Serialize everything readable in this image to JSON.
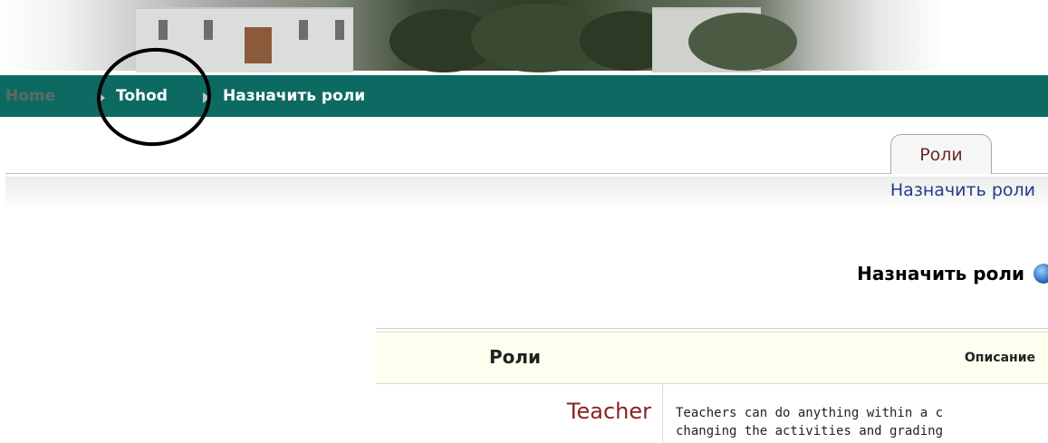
{
  "breadcrumb": {
    "home": "Home",
    "course": "Tohod",
    "current": "Назначить роли"
  },
  "tabs": {
    "active_label": "Роли",
    "sub_link": "Назначить роли"
  },
  "main": {
    "heading": "Назначить роли"
  },
  "table": {
    "headers": {
      "roles": "Роли",
      "description": "Описание"
    },
    "rows": [
      {
        "role": "Teacher",
        "description_line1": "Teachers can do anything within a c",
        "description_line2": "changing the activities and grading"
      }
    ]
  },
  "colors": {
    "navbar": "#0d6a63",
    "role_link": "#8b2323",
    "sub_link": "#223c8c",
    "table_header_bg": "#fffff0"
  },
  "icons": {
    "help": "help-icon",
    "breadcrumb_separator": "breadcrumb-arrow-icon"
  }
}
